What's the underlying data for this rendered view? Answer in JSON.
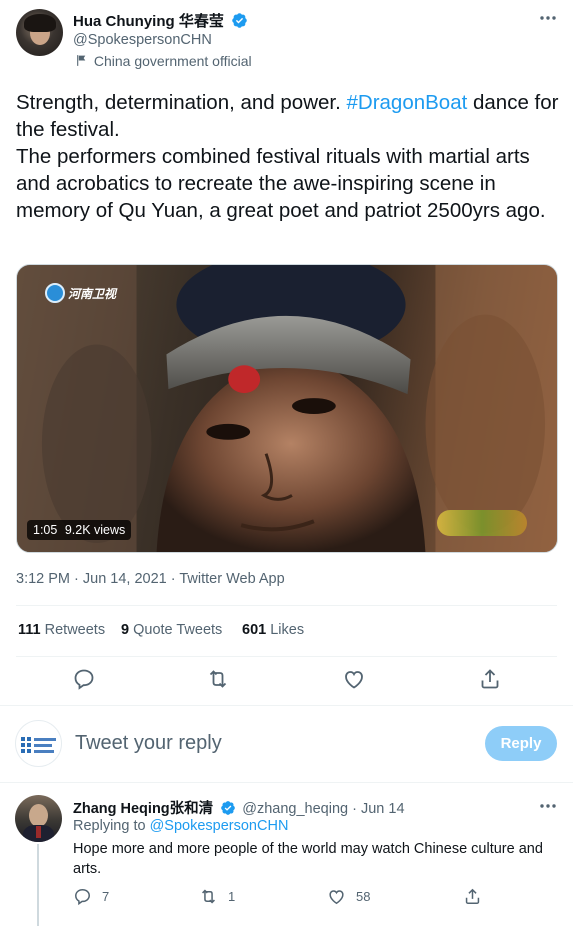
{
  "author": {
    "name": "Hua Chunying 华春莹",
    "handle": "@SpokespersonCHN",
    "label": "China government official"
  },
  "tweet": {
    "text_before_tag": "Strength, determination, and power. ",
    "hashtag": "#DragonBoat",
    "text_after_tag": " dance for the festival.",
    "paragraph2": "The performers combined festival rituals with martial arts and acrobatics to recreate the awe-inspiring scene in memory of Qu Yuan, a great poet and patriot 2500yrs ago."
  },
  "video": {
    "duration": "1:05",
    "views": "9.2K views",
    "channel_logo_text": "河南卫视"
  },
  "meta": {
    "timestamp": "3:12 PM · Jun 14, 2021 · Twitter Web App"
  },
  "stats": {
    "retweets_count": "111",
    "retweets_label": "Retweets",
    "quotes_count": "9",
    "quotes_label": "Quote Tweets",
    "likes_count": "601",
    "likes_label": "Likes"
  },
  "reply_box": {
    "placeholder": "Tweet your reply",
    "button": "Reply"
  },
  "reply": {
    "name": "Zhang Heqing张和清",
    "handle": "@zhang_heqing",
    "date": "· Jun 14",
    "replying_prefix": "Replying to ",
    "replying_to": "@SpokespersonCHN",
    "text": "Hope more and more people of the world may watch Chinese culture and arts.",
    "reply_count": "7",
    "retweet_count": "1",
    "like_count": "58"
  },
  "colors": {
    "accent": "#1d9bf0",
    "verified": "#1d9bf0",
    "secondary_text": "#536471",
    "reply_button_disabled": "#8ecdf8"
  }
}
